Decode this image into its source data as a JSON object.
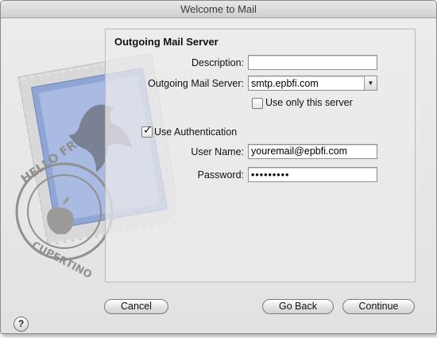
{
  "window": {
    "title": "Welcome to Mail"
  },
  "panel": {
    "heading": "Outgoing Mail Server",
    "description": {
      "label": "Description:",
      "value": ""
    },
    "server": {
      "label": "Outgoing Mail Server:",
      "value": "smtp.epbfi.com"
    },
    "use_only": {
      "label": "Use only this server",
      "checked": false
    },
    "use_auth": {
      "label": "Use Authentication",
      "checked": true
    },
    "username": {
      "label": "User Name:",
      "value": "youremail@epbfi.com"
    },
    "password": {
      "label": "Password:",
      "value": "•••••••••"
    }
  },
  "stamp": {
    "text_top": "HELLO FR",
    "text_bottom": "CUPERTINO"
  },
  "footer": {
    "help_label": "?",
    "cancel_label": "Cancel",
    "back_label": "Go Back",
    "continue_label": "Continue"
  },
  "icons": {
    "help": "help-icon",
    "dropdown": "chevron-down-icon",
    "checkmark": "checkmark-icon"
  }
}
